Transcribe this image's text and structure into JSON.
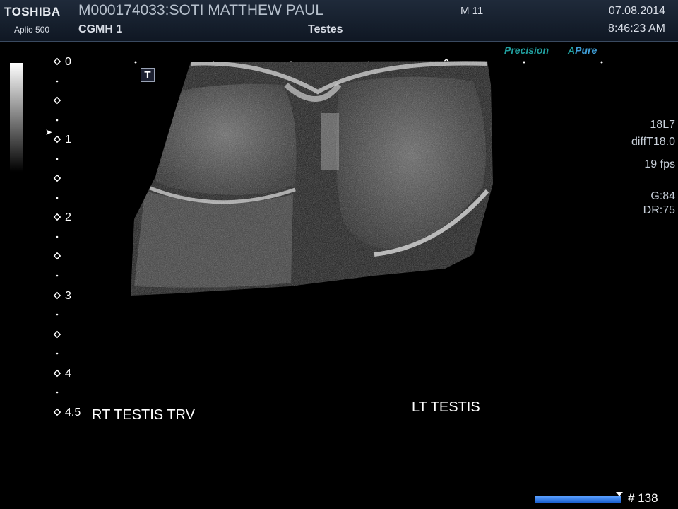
{
  "header": {
    "brand": "TOSHIBA",
    "model": "Aplio 500",
    "patient": "M000174033:SOTI MATTHEW PAUL",
    "site": "CGMH 1",
    "exam": "Testes",
    "mode": "M 11",
    "date": "07.08.2014",
    "time": "8:46:23 AM"
  },
  "logos": {
    "precision": "Precision",
    "apure_a": "A",
    "apure_rest": "Pure"
  },
  "orientation_marker": "T",
  "depth_scale": {
    "labels": [
      "0",
      "1",
      "2",
      "3",
      "4",
      "4.5"
    ]
  },
  "parameters": {
    "probe": "18L7",
    "preset": "diffT18.0",
    "fps": "19 fps",
    "gain": "G:84",
    "dynamic_range": "DR:75"
  },
  "annotations": {
    "left": "RT TESTIS TRV",
    "right": "LT TESTIS"
  },
  "cine": {
    "frame": "# 138"
  },
  "colors": {
    "header_bg": "#1a2433",
    "logo_teal": "#21a0a0",
    "cine_blue": "#2a74e0"
  }
}
